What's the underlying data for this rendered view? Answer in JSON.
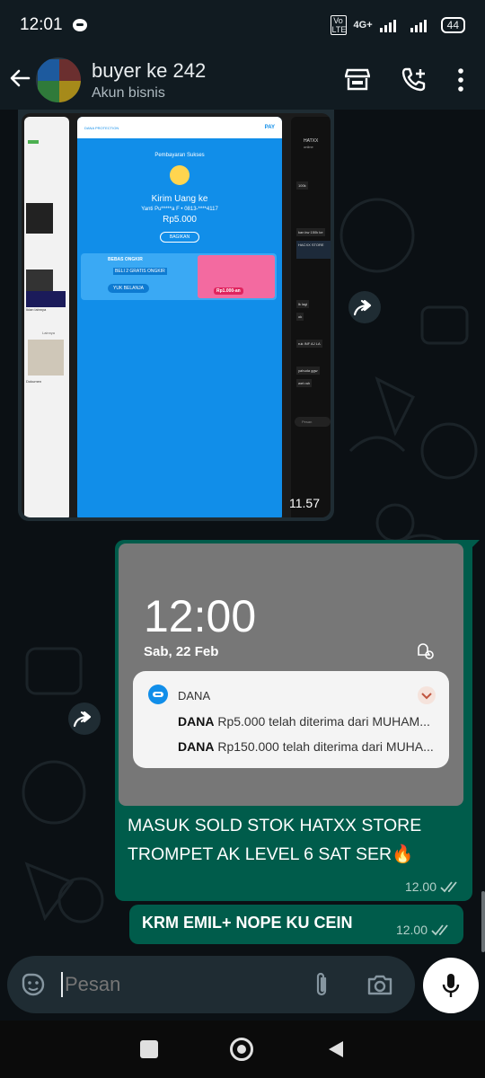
{
  "status": {
    "time": "12:01",
    "network": "4G+",
    "volte": "Vo LTE",
    "battery": "44"
  },
  "header": {
    "title": "buyer ke 242",
    "subtitle": "Akun bisnis"
  },
  "image_message": {
    "time": "11.57",
    "payment": {
      "brand": "DANA PROTECTION",
      "pay": "PAY",
      "status": "Pembayaran Sukses",
      "heading": "Kirim Uang ke",
      "recipient": "Yanti Pu*****a F • 0813-****4117",
      "amount": "Rp5.000",
      "share": "BAGIKAN",
      "promo_top": "BEBAS ONGKIR",
      "promo_mid": "BELI 2 GRATIS ONGKIR",
      "promo_btn": "YUK BELANJA",
      "promo_price": "Rp1.000-an"
    },
    "right_chat": {
      "name": "HATXX",
      "status": "online",
      "m1": "100k",
      "m2": "kan kw 150k ke",
      "m3": "HACXX STORE",
      "m4": "lk lagi",
      "m5": "ok",
      "m6": "ruk INF AJ LA",
      "m7": "yahuda ggw",
      "m8": "wet rah",
      "input": "Pesan"
    },
    "left_screen": {
      "a": "Iklan lainnya",
      "b": "Dokumen",
      "c": "Lainnya"
    }
  },
  "notification_message": {
    "lock_time": "12:00",
    "lock_date": "Sab, 22 Feb",
    "app_name": "DANA",
    "line1_bold": "DANA",
    "line1_text": "Rp5.000 telah diterima dari MUHAM...",
    "line2_bold": "DANA",
    "line2_text": "Rp150.000 telah diterima dari MUHA...",
    "caption": "MASUK SOLD STOK HATXX STORE TROMPET AK LEVEL 6 SAT SER🔥",
    "time": "12.00"
  },
  "text_message": {
    "text": "KRM EMIL+ NOPE KU CEIN",
    "time": "12.00"
  },
  "composer": {
    "placeholder": "Pesan"
  },
  "colors": {
    "header_bg": "#111b21",
    "outgoing_bubble": "#005c4b",
    "chat_bg": "#0b1014",
    "dana_blue": "#118ee9"
  }
}
